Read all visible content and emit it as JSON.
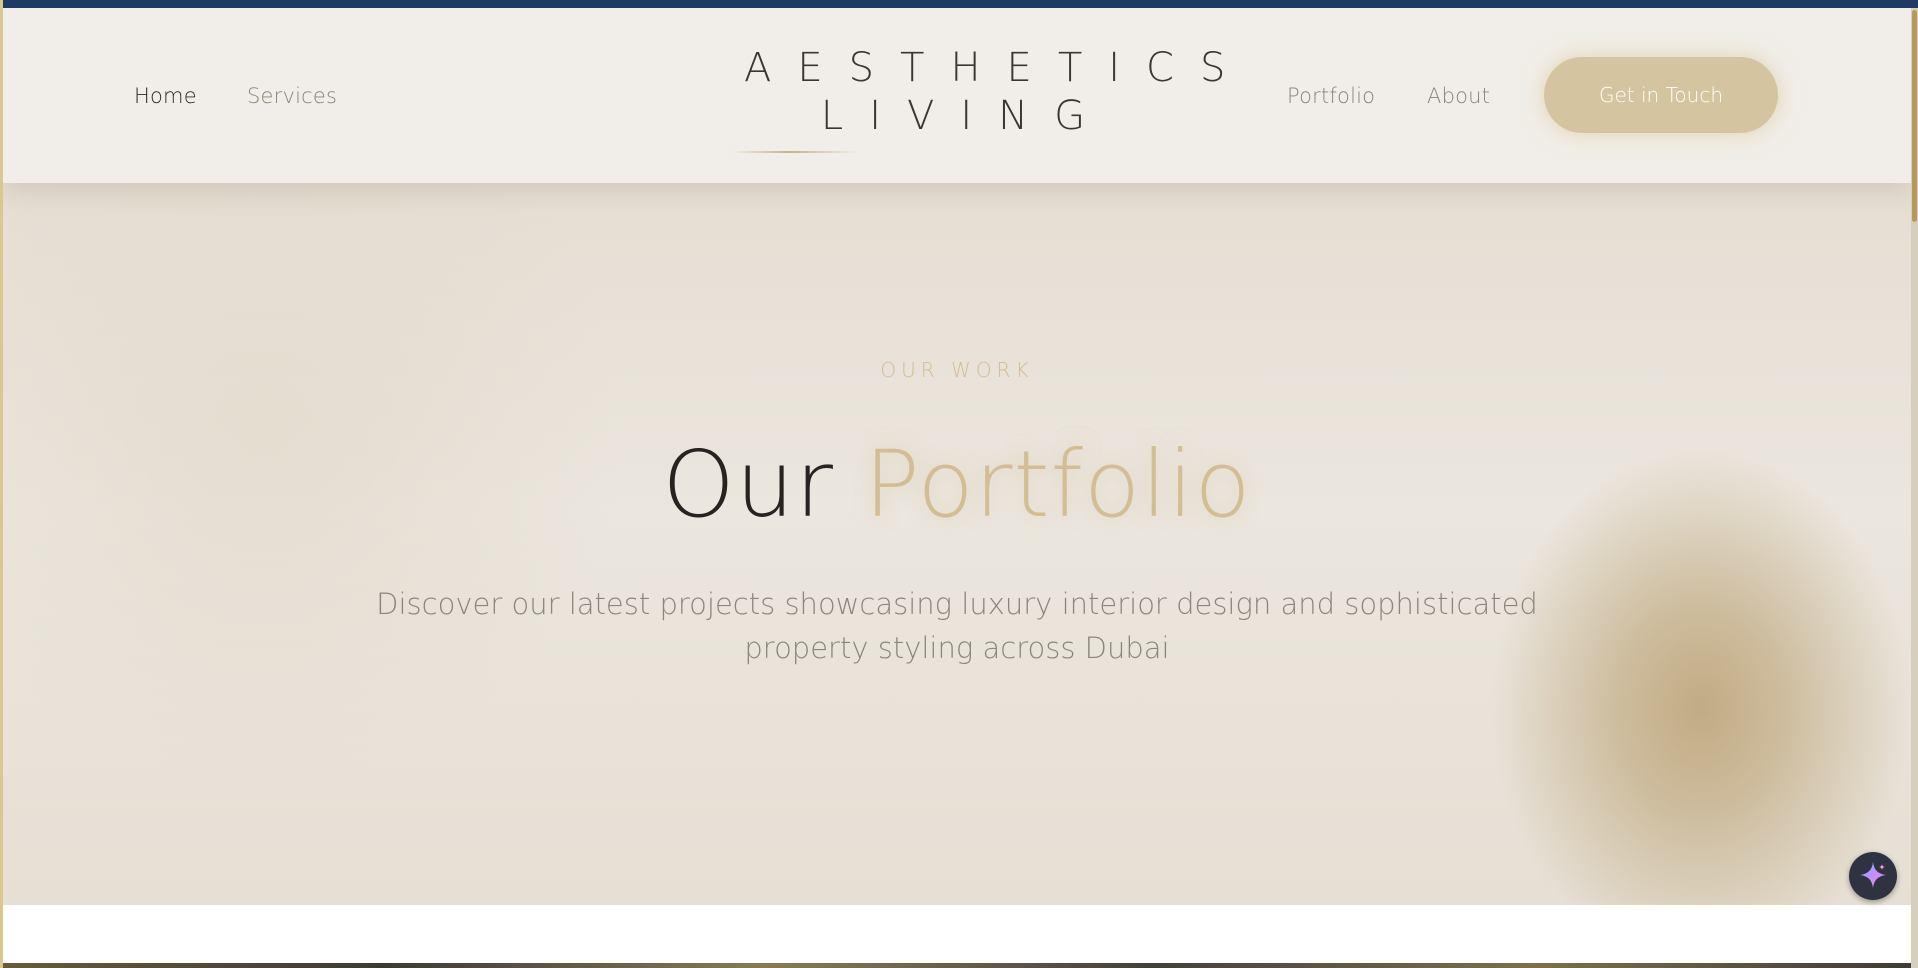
{
  "header": {
    "logo": {
      "line1": "AESTHETICS",
      "line2": "LIVING"
    },
    "nav_left": [
      {
        "label": "Home",
        "active": true
      },
      {
        "label": "Services",
        "active": false
      }
    ],
    "nav_right": [
      {
        "label": "Portfolio",
        "active": false
      },
      {
        "label": "About",
        "active": false
      }
    ],
    "cta_label": "Get in Touch"
  },
  "hero": {
    "eyebrow": "OUR WORK",
    "title_main": "Our",
    "title_accent": "Portfolio",
    "subtitle": "Discover our latest projects showcasing luxury interior design and sophisticated property styling across Dubai"
  },
  "colors": {
    "accent_gold": "#d3bd93",
    "button_gold": "#d4c5a0",
    "heading_dark": "#262320",
    "top_strip_navy": "#1f3a63"
  },
  "icons": {
    "fab": "sparkle-icon"
  }
}
